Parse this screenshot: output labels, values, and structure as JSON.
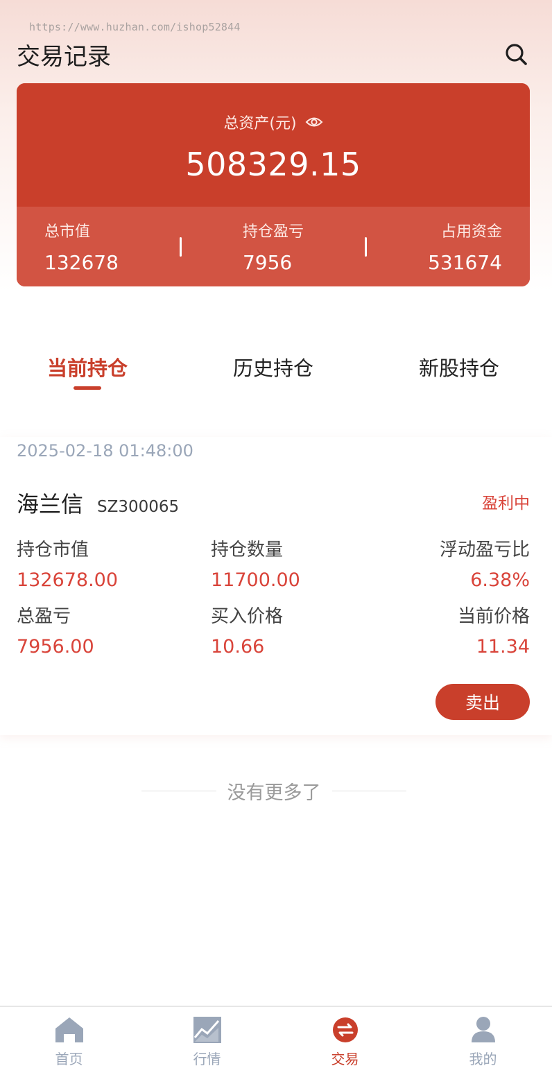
{
  "watermark": "https://www.huzhan.com/ishop52844",
  "header": {
    "title": "交易记录",
    "search_icon": "search-icon"
  },
  "asset_card": {
    "label": "总资产(元)",
    "value": "508329.15",
    "stats": [
      {
        "label": "总市值",
        "value": "132678"
      },
      {
        "label": "持仓盈亏",
        "value": "7956"
      },
      {
        "label": "占用资金",
        "value": "531674"
      }
    ]
  },
  "tabs": [
    {
      "label": "当前持仓",
      "active": true
    },
    {
      "label": "历史持仓",
      "active": false
    },
    {
      "label": "新股持仓",
      "active": false
    }
  ],
  "position": {
    "date": "2025-02-18 01:48:00",
    "name": "海兰信",
    "code": "SZ300065",
    "status": "盈利中",
    "fields": [
      {
        "label": "持仓市值",
        "value": "132678.00"
      },
      {
        "label": "持仓数量",
        "value": "11700.00"
      },
      {
        "label": "浮动盈亏比",
        "value": "6.38%"
      },
      {
        "label": "总盈亏",
        "value": "7956.00"
      },
      {
        "label": "买入价格",
        "value": "10.66"
      },
      {
        "label": "当前价格",
        "value": "11.34"
      }
    ],
    "sell_label": "卖出"
  },
  "no_more": "没有更多了",
  "tabbar": [
    {
      "label": "首页",
      "icon": "home-icon"
    },
    {
      "label": "行情",
      "icon": "chart-icon"
    },
    {
      "label": "交易",
      "icon": "exchange-icon",
      "active": true
    },
    {
      "label": "我的",
      "icon": "user-icon"
    }
  ],
  "colors": {
    "primary": "#c93f2b",
    "profit": "#d9443a",
    "muted": "#9aa6b8"
  }
}
